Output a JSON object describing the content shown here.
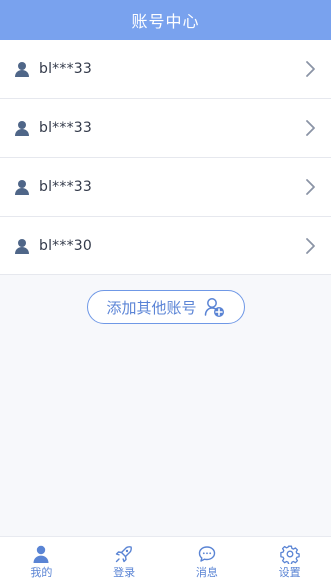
{
  "header": {
    "title": "账号中心"
  },
  "accounts": [
    {
      "name": "bl***33"
    },
    {
      "name": "bl***33"
    },
    {
      "name": "bl***33"
    },
    {
      "name": "bl***30"
    }
  ],
  "add_account": {
    "label": "添加其他账号"
  },
  "tabs": [
    {
      "label": "我的"
    },
    {
      "label": "登录"
    },
    {
      "label": "消息"
    },
    {
      "label": "设置"
    }
  ],
  "colors": {
    "header": "#79a2ee",
    "accent": "#5a84d4",
    "icon": "#4f6688"
  },
  "icons": {
    "account": "user-icon",
    "row_arrow": "chevron-right-icon",
    "add": "add-user-icon",
    "tabs": [
      "user-icon",
      "rocket-icon",
      "chat-bubble-icon",
      "gear-icon"
    ]
  }
}
